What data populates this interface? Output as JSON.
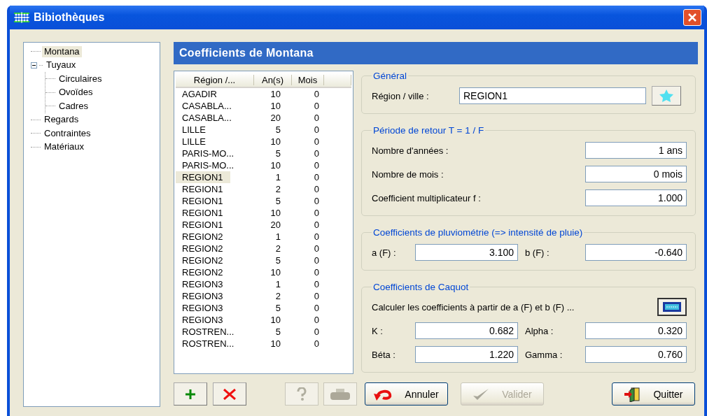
{
  "window": {
    "title": "Bibiothèques"
  },
  "tree": [
    {
      "label": "Montana",
      "selected": true
    },
    {
      "label": "Tuyaux",
      "selected": false,
      "expanded": true,
      "children": [
        {
          "label": "Circulaires",
          "selected": false
        },
        {
          "label": "Ovoïdes",
          "selected": false
        },
        {
          "label": "Cadres",
          "selected": false
        }
      ]
    },
    {
      "label": "Regards",
      "selected": false
    },
    {
      "label": "Contraintes",
      "selected": false
    },
    {
      "label": "Matériaux",
      "selected": false
    }
  ],
  "panel_title": "Coefficients de Montana",
  "table": {
    "columns": [
      "Région /...",
      "An(s)",
      "Mois"
    ],
    "rows": [
      {
        "cells": [
          "AGADIR",
          "10",
          "0"
        ],
        "selected": false
      },
      {
        "cells": [
          "CASABLA...",
          "10",
          "0"
        ],
        "selected": false
      },
      {
        "cells": [
          "CASABLA...",
          "20",
          "0"
        ],
        "selected": false
      },
      {
        "cells": [
          "LILLE",
          "5",
          "0"
        ],
        "selected": false
      },
      {
        "cells": [
          "LILLE",
          "10",
          "0"
        ],
        "selected": false
      },
      {
        "cells": [
          "PARIS-MO...",
          "5",
          "0"
        ],
        "selected": false
      },
      {
        "cells": [
          "PARIS-MO...",
          "10",
          "0"
        ],
        "selected": false
      },
      {
        "cells": [
          "REGION1",
          "1",
          "0"
        ],
        "selected": true
      },
      {
        "cells": [
          "REGION1",
          "2",
          "0"
        ],
        "selected": false
      },
      {
        "cells": [
          "REGION1",
          "5",
          "0"
        ],
        "selected": false
      },
      {
        "cells": [
          "REGION1",
          "10",
          "0"
        ],
        "selected": false
      },
      {
        "cells": [
          "REGION1",
          "20",
          "0"
        ],
        "selected": false
      },
      {
        "cells": [
          "REGION2",
          "1",
          "0"
        ],
        "selected": false
      },
      {
        "cells": [
          "REGION2",
          "2",
          "0"
        ],
        "selected": false
      },
      {
        "cells": [
          "REGION2",
          "5",
          "0"
        ],
        "selected": false
      },
      {
        "cells": [
          "REGION2",
          "10",
          "0"
        ],
        "selected": false
      },
      {
        "cells": [
          "REGION3",
          "1",
          "0"
        ],
        "selected": false
      },
      {
        "cells": [
          "REGION3",
          "2",
          "0"
        ],
        "selected": false
      },
      {
        "cells": [
          "REGION3",
          "5",
          "0"
        ],
        "selected": false
      },
      {
        "cells": [
          "REGION3",
          "10",
          "0"
        ],
        "selected": false
      },
      {
        "cells": [
          "ROSTREN...",
          "5",
          "0"
        ],
        "selected": false
      },
      {
        "cells": [
          "ROSTREN...",
          "10",
          "0"
        ],
        "selected": false
      }
    ]
  },
  "list_buttons": [
    {
      "kind": "add",
      "disabled": false
    },
    {
      "kind": "delete",
      "disabled": false
    },
    {
      "kind": "help",
      "disabled": true
    },
    {
      "kind": "print",
      "disabled": true
    }
  ],
  "general": {
    "legend": "Général",
    "label": "Région / ville :",
    "value": "REGION1"
  },
  "period": {
    "legend": "Période de retour T = 1 / F",
    "fields": [
      {
        "label": "Nombre d'années :",
        "value": "1 ans"
      },
      {
        "label": "Nombre de mois :",
        "value": "0 mois"
      },
      {
        "label": "Coefficient multiplicateur f :",
        "value": "1.000"
      }
    ]
  },
  "pluvio": {
    "legend": "Coefficients de pluviométrie (=> intensité de pluie)",
    "fields": [
      {
        "label": "a (F) :",
        "value": "3.100"
      },
      {
        "label": "b (F) :",
        "value": "-0.640"
      }
    ]
  },
  "caquot": {
    "legend": "Coefficients de Caquot",
    "calc_label": "Calculer les coefficients à partir de a (F) et b (F) ...",
    "fields": [
      {
        "label": "K :",
        "value": "0.682"
      },
      {
        "label": "Alpha :",
        "value": "0.320"
      },
      {
        "label": "Béta :",
        "value": "1.220"
      },
      {
        "label": "Gamma :",
        "value": "0.760"
      }
    ]
  },
  "actions": [
    {
      "kind": "cancel",
      "label": "Annuler",
      "disabled": false
    },
    {
      "kind": "validate",
      "label": "Valider",
      "disabled": true
    },
    {
      "kind": "quit",
      "label": "Quitter",
      "disabled": false
    }
  ]
}
